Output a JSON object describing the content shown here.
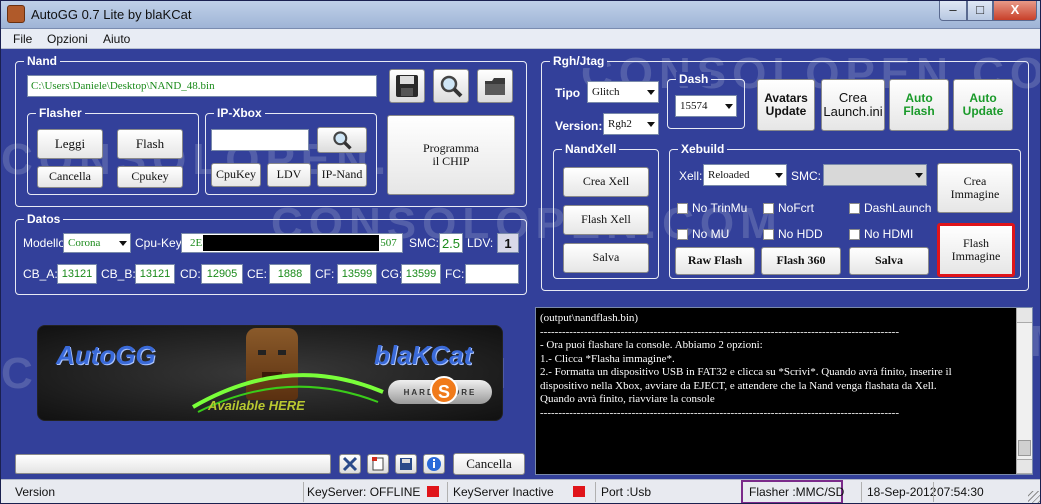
{
  "window": {
    "title": "AutoGG 0.7 Lite by blaKCat",
    "min": "–",
    "max": "□",
    "close": "X"
  },
  "menu": {
    "file": "File",
    "options": "Opzioni",
    "help": "Aiuto"
  },
  "nand": {
    "label": "Nand",
    "path": "C:\\Users\\Daniele\\Desktop\\NAND_48.bin",
    "flasher": {
      "label": "Flasher",
      "read": "Leggi",
      "flash": "Flash",
      "erase": "Cancella",
      "cpukey": "Cpukey"
    },
    "ipxbox": {
      "label": "IP-Xbox",
      "ip_value": "",
      "cpukey": "CpuKey",
      "ldv": "LDV",
      "ipnand": "IP-Nand"
    },
    "program_chip": "Programma\nil CHIP"
  },
  "datos": {
    "label": "Datos",
    "model_label": "Modello:",
    "model_value": "Corona",
    "cpukey_label": "Cpu-Key:",
    "cpukey_start": "2E",
    "cpukey_end": "507",
    "smc_label": "SMC:",
    "smc_value": "2.5",
    "ldv_label": "LDV:",
    "ldv_value": "1",
    "cb": [
      {
        "label": "CB_A:",
        "value": "13121"
      },
      {
        "label": "CB_B:",
        "value": "13121"
      },
      {
        "label": "CD:",
        "value": "12905"
      },
      {
        "label": "CE:",
        "value": "1888"
      },
      {
        "label": "CF:",
        "value": "13599"
      },
      {
        "label": "CG:",
        "value": "13599"
      },
      {
        "label": "FC:",
        "value": ""
      }
    ]
  },
  "rgh": {
    "label": "Rgh/Jtag",
    "tipo_label": "Tipo",
    "tipo_value": "Glitch",
    "version_label": "Version:",
    "version_value": "Rgh2",
    "dash_label": "Dash",
    "dash_value": "15574",
    "avatars": "Avatars\nUpdate",
    "crea_launch": "Crea\nLaunch.ini",
    "auto_flash": "Auto\nFlash",
    "auto_update": "Auto\nUpdate",
    "nandxell": {
      "label": "NandXell",
      "crea": "Crea Xell",
      "flash": "Flash Xell",
      "salva": "Salva"
    },
    "xebuild": {
      "label": "Xebuild",
      "xell_label": "Xell:",
      "xell_value": "Reloaded",
      "smc_label": "SMC:",
      "checks": [
        "No TrinMu",
        "NoFcrt",
        "DashLaunch",
        "No MU",
        "No HDD",
        "No HDMI"
      ],
      "raw_flash": "Raw Flash",
      "flash360": "Flash 360",
      "salva": "Salva",
      "crea_immagine": "Crea\nImmagine",
      "flash_immagine": "Flash\nImmagine"
    }
  },
  "banner": {
    "left": "AutoGG",
    "right": "blaKCat",
    "available": "Available HERE",
    "store": "HARD STORE"
  },
  "watermark": "CONSOLOPEN.COM",
  "log": {
    "lines": [
      "(output\\nandflash.bin)",
      "",
      "--------------------------------------------------------------------------------------------------",
      "- Ora puoi flashare la console. Abbiamo 2 opzioni:",
      "1.- Clicca *Flasha immagine*.",
      "2.- Formatta un dispositivo USB in FAT32 e clicca su *Scrivi*. Quando avrà finito, inserire il",
      "dispositivo nella Xbox, avviare da EJECT, e attendere che la Nand venga flashata da Xell.",
      "Quando avrà finito, riavviare la console",
      "",
      "--------------------------------------------------------------------------------------------------"
    ]
  },
  "bottom": {
    "cancel": "Cancella"
  },
  "status": {
    "version": "Version",
    "keyserver": "KeyServer: OFFLINE",
    "keyserver_inactive": "KeyServer Inactive",
    "port": "Port :Usb",
    "flasher": "Flasher :MMC/SD",
    "date": "18-Sep-2012",
    "time": "07:54:30"
  },
  "colors": {
    "bg": "#33409a",
    "accent_green": "#1a9a2a",
    "status_red": "#e0141a",
    "highlight_red": "#e0141a",
    "highlight_purple": "#7a2a8a"
  }
}
